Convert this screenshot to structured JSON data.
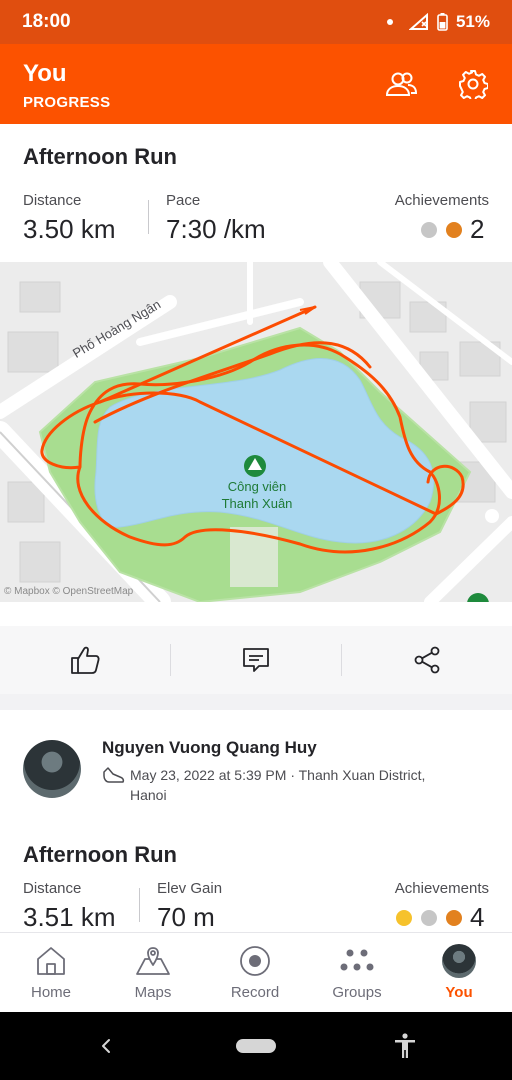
{
  "status_bar": {
    "time": "18:00",
    "battery": "51%"
  },
  "header": {
    "title": "You",
    "subtitle": "PROGRESS",
    "icons": [
      "people-icon",
      "gear-icon"
    ]
  },
  "activity1": {
    "title": "Afternoon Run",
    "stats": [
      {
        "label": "Distance",
        "value": "3.50 km"
      },
      {
        "label": "Pace",
        "value": "7:30 /km"
      }
    ],
    "achievements_label": "Achievements",
    "achievements_count": "2",
    "medals": [
      "silver",
      "bronze"
    ],
    "map": {
      "street_label": "Phố Hoàng Ngân",
      "park_label_line1": "Công viên",
      "park_label_line2": "Thanh Xuân",
      "attribution": "© Mapbox © OpenStreetMap",
      "colors": {
        "route": "#fc4c02",
        "water": "#aad8f0",
        "park": "#a8dd90",
        "road": "#ffffff",
        "block": "#dcdcdc"
      }
    },
    "actions": [
      "like-icon",
      "comment-icon",
      "share-icon"
    ]
  },
  "activity2": {
    "athlete_name": "Nguyen Vuong Quang Huy",
    "date_location_line1": "May 23, 2022 at 5:39 PM · Thanh Xuan District,",
    "date_location_line2": "Hanoi",
    "title": "Afternoon Run",
    "stats": [
      {
        "label": "Distance",
        "value": "3.51 km"
      },
      {
        "label": "Elev Gain",
        "value": "70 m"
      }
    ],
    "achievements_label": "Achievements",
    "achievements_count": "4",
    "medals": [
      "gold",
      "silver",
      "bronze"
    ]
  },
  "bottom_nav": {
    "items": [
      {
        "label": "Home",
        "icon": "home-icon"
      },
      {
        "label": "Maps",
        "icon": "map-icon"
      },
      {
        "label": "Record",
        "icon": "record-icon"
      },
      {
        "label": "Groups",
        "icon": "groups-icon"
      },
      {
        "label": "You",
        "icon": "avatar-icon",
        "active": true
      }
    ]
  },
  "theme": {
    "accent": "#fc5200",
    "status_bar": "#e04e0f",
    "gold": "#f6c22c",
    "silver": "#c6c6c6",
    "bronze": "#e2811f"
  }
}
